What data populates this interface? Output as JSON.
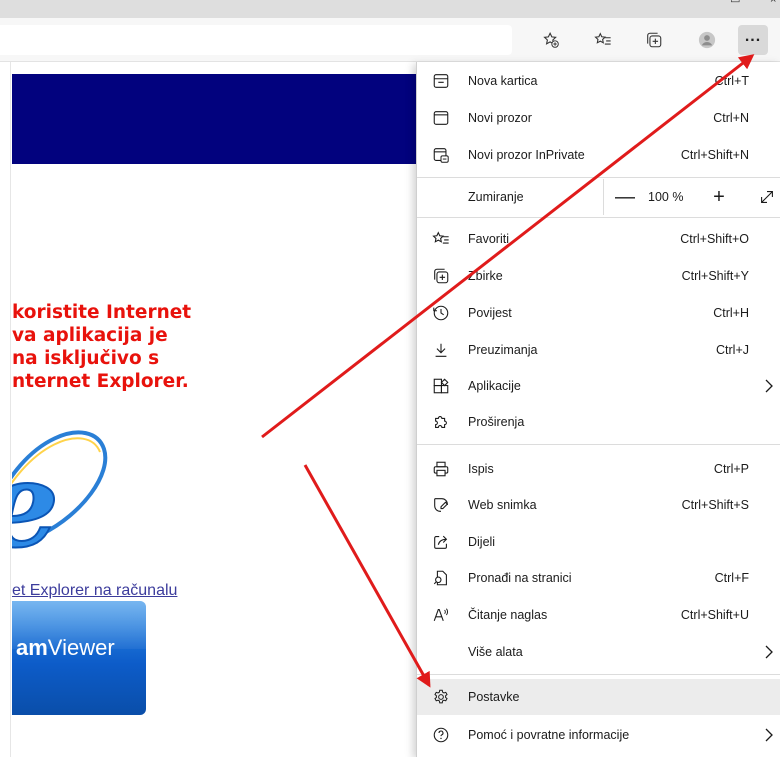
{
  "toolbar": {
    "icons": [
      "add-favorite-icon",
      "favorites-icon",
      "collections-icon",
      "profile-icon"
    ],
    "more_label": "..."
  },
  "page": {
    "warning_lines": "koristite Internet\nva aplikacija je\nna isključivo s\nnternet Explorer.",
    "ie_link": "et Explorer na računalu",
    "teamviewer_bold": "am",
    "teamviewer_rest": "Viewer"
  },
  "menu": {
    "new_tab": {
      "label": "Nova kartica",
      "shortcut": "Ctrl+T"
    },
    "new_window": {
      "label": "Novi prozor",
      "shortcut": "Ctrl+N"
    },
    "new_inprivate": {
      "label": "Novi prozor InPrivate",
      "shortcut": "Ctrl+Shift+N"
    },
    "zoom": {
      "label": "Zumiranje",
      "minus": "—",
      "value": "100 %",
      "plus": "+"
    },
    "favorites": {
      "label": "Favoriti",
      "shortcut": "Ctrl+Shift+O"
    },
    "collections": {
      "label": "Zbirke",
      "shortcut": "Ctrl+Shift+Y"
    },
    "history": {
      "label": "Povijest",
      "shortcut": "Ctrl+H"
    },
    "downloads": {
      "label": "Preuzimanja",
      "shortcut": "Ctrl+J"
    },
    "apps": {
      "label": "Aplikacije"
    },
    "extensions": {
      "label": "Proširenja"
    },
    "print": {
      "label": "Ispis",
      "shortcut": "Ctrl+P"
    },
    "web_capture": {
      "label": "Web snimka",
      "shortcut": "Ctrl+Shift+S"
    },
    "share": {
      "label": "Dijeli"
    },
    "find": {
      "label": "Pronađi na stranici",
      "shortcut": "Ctrl+F"
    },
    "read_aloud": {
      "label": "Čitanje naglas",
      "shortcut": "Ctrl+Shift+U"
    },
    "more_tools": {
      "label": "Više alata"
    },
    "settings": {
      "label": "Postavke"
    },
    "help": {
      "label": "Pomoć i povratne informacije"
    }
  },
  "colors": {
    "banner": "#02027e",
    "warning_text": "#e8120c",
    "annotation_arrow": "#e01b1b",
    "menu_hover": "#ececec"
  }
}
